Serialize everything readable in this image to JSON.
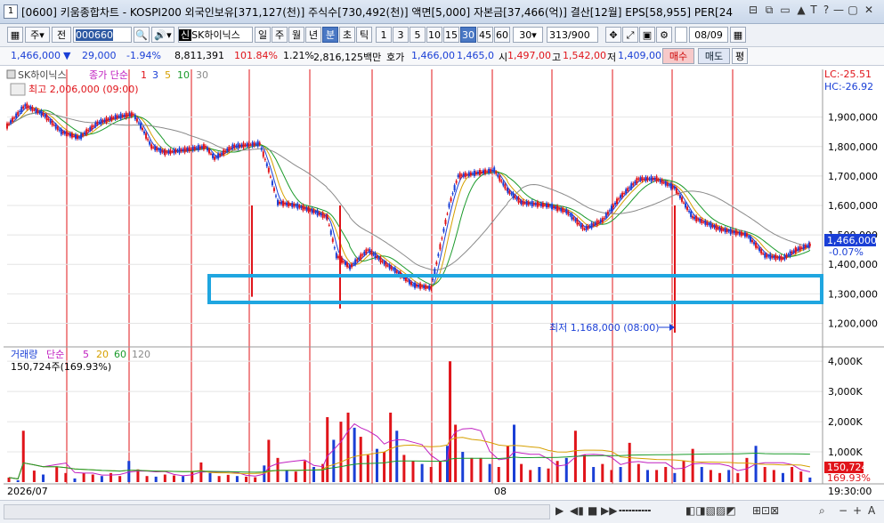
{
  "window": {
    "number": "1",
    "title": "[0600] 키움종합차트 - KOSPI200 외국인보유[371,127(천)] 주식수[730,492(천)] 액면[5,000] 자본금[37,466(억)] 결산[12월] EPS[58,955] PER[24",
    "controls": [
      "⊟",
      "⧉",
      "▭",
      "▲",
      "T",
      "?",
      "—",
      "▢",
      "✕"
    ]
  },
  "toolbar": {
    "mode1": "주",
    "mode2": "전",
    "code": "000660",
    "stock_name": "SK하이닉스",
    "periods": [
      "일",
      "주",
      "월",
      "년",
      "분",
      "초",
      "틱"
    ],
    "selected_period": "분",
    "intervals": [
      "1",
      "3",
      "5",
      "10",
      "15",
      "30",
      "45",
      "60"
    ],
    "selected_interval": "30",
    "interval_value": "30",
    "count": "313",
    "count_max": "/900",
    "date": "08/09"
  },
  "quote": {
    "price": "1,466,000",
    "arrow": "▼",
    "change": "29,000",
    "change_pct": "-1.94%",
    "volume": "8,811,391",
    "volume_ratio": "101.84%",
    "turnover": "1.21%",
    "amount": "2,816,125백만",
    "bid_label": "호가",
    "bid": "1,466,00",
    "ask": "1,465,0",
    "open_label": "시",
    "open": "1,497,00",
    "high_label": "고",
    "high": "1,542,00",
    "low_label": "저",
    "low": "1,409,00",
    "buy_label": "매수",
    "sell_label": "매도",
    "eval_label": "평"
  },
  "price_panel": {
    "legend_name": "SK하이닉스",
    "legend_ma": "종가 단순",
    "ma_periods": [
      "1",
      "3",
      "5",
      "10",
      "30"
    ],
    "high_note": "최고 2,006,000 (09:00)",
    "low_note": "최저 1,168,000 (08:00)",
    "lc": "LC:-25.51",
    "hc": "HC:-26.92",
    "current_price_tag": "1,466,000",
    "current_pct_tag": "-0.07%",
    "y_ticks": [
      "1,900,000",
      "1,800,000",
      "1,700,000",
      "1,600,000",
      "1,500,000",
      "1,400,000",
      "1,300,000",
      "1,200,000"
    ]
  },
  "volume_panel": {
    "legend_name": "거래량",
    "legend_ma": "단순",
    "ma_periods": [
      "5",
      "20",
      "60",
      "120"
    ],
    "summary": "150,724주(169.93%)",
    "current_tag": "150,724",
    "current_pct_tag": "169.93%",
    "y_ticks": [
      "4,000K",
      "3,000K",
      "2,000K",
      "1,000K"
    ]
  },
  "x_axis": {
    "labels": [
      "2026/07",
      "08"
    ],
    "time": "19:30:00"
  },
  "colors": {
    "up": "#e0141a",
    "down": "#1a3fd6",
    "highlight_box": "#1fa6e0",
    "ma1": "#e0141a",
    "ma3": "#1a3fd6",
    "ma5": "#d6a000",
    "ma10": "#1a9a2a",
    "ma30": "#8a8a8a"
  },
  "chart_data": {
    "type": "line",
    "price_path": [
      [
        0,
        1870000
      ],
      [
        20,
        1940000
      ],
      [
        40,
        1910000
      ],
      [
        60,
        1850000
      ],
      [
        80,
        1830000
      ],
      [
        100,
        1880000
      ],
      [
        120,
        1900000
      ],
      [
        140,
        1910000
      ],
      [
        150,
        1860000
      ],
      [
        160,
        1800000
      ],
      [
        175,
        1780000
      ],
      [
        200,
        1790000
      ],
      [
        220,
        1800000
      ],
      [
        230,
        1760000
      ],
      [
        250,
        1800000
      ],
      [
        280,
        1810000
      ],
      [
        290,
        1720000
      ],
      [
        300,
        1610000
      ],
      [
        320,
        1600000
      ],
      [
        340,
        1580000
      ],
      [
        355,
        1560000
      ],
      [
        365,
        1430000
      ],
      [
        380,
        1390000
      ],
      [
        400,
        1450000
      ],
      [
        420,
        1400000
      ],
      [
        430,
        1380000
      ],
      [
        450,
        1330000
      ],
      [
        470,
        1320000
      ],
      [
        490,
        1600000
      ],
      [
        500,
        1700000
      ],
      [
        520,
        1710000
      ],
      [
        540,
        1720000
      ],
      [
        555,
        1650000
      ],
      [
        570,
        1610000
      ],
      [
        600,
        1600000
      ],
      [
        620,
        1580000
      ],
      [
        640,
        1520000
      ],
      [
        660,
        1550000
      ],
      [
        680,
        1630000
      ],
      [
        700,
        1690000
      ],
      [
        720,
        1690000
      ],
      [
        740,
        1660000
      ],
      [
        760,
        1560000
      ],
      [
        790,
        1520000
      ],
      [
        820,
        1500000
      ],
      [
        840,
        1430000
      ],
      [
        860,
        1420000
      ],
      [
        875,
        1450000
      ],
      [
        890,
        1466000
      ]
    ],
    "volume_bars": [
      [
        2,
        150
      ],
      [
        12,
        60
      ],
      [
        18,
        1700
      ],
      [
        30,
        380
      ],
      [
        40,
        250
      ],
      [
        55,
        520
      ],
      [
        65,
        300
      ],
      [
        75,
        120
      ],
      [
        85,
        300
      ],
      [
        95,
        250
      ],
      [
        105,
        200
      ],
      [
        115,
        300
      ],
      [
        125,
        200
      ],
      [
        135,
        700
      ],
      [
        145,
        420
      ],
      [
        155,
        200
      ],
      [
        165,
        180
      ],
      [
        175,
        250
      ],
      [
        185,
        220
      ],
      [
        195,
        200
      ],
      [
        205,
        340
      ],
      [
        215,
        650
      ],
      [
        225,
        300
      ],
      [
        235,
        200
      ],
      [
        245,
        240
      ],
      [
        255,
        200
      ],
      [
        265,
        180
      ],
      [
        275,
        160
      ],
      [
        285,
        550
      ],
      [
        290,
        1400
      ],
      [
        300,
        800
      ],
      [
        310,
        400
      ],
      [
        320,
        350
      ],
      [
        330,
        700
      ],
      [
        340,
        500
      ],
      [
        350,
        600
      ],
      [
        355,
        2150
      ],
      [
        362,
        1400
      ],
      [
        370,
        2000
      ],
      [
        378,
        2300
      ],
      [
        385,
        1800
      ],
      [
        392,
        1500
      ],
      [
        400,
        900
      ],
      [
        410,
        1100
      ],
      [
        418,
        1000
      ],
      [
        425,
        2300
      ],
      [
        432,
        1700
      ],
      [
        440,
        900
      ],
      [
        450,
        700
      ],
      [
        460,
        600
      ],
      [
        470,
        500
      ],
      [
        480,
        700
      ],
      [
        488,
        1200
      ],
      [
        491,
        4000
      ],
      [
        497,
        1900
      ],
      [
        505,
        1000
      ],
      [
        515,
        800
      ],
      [
        525,
        800
      ],
      [
        535,
        600
      ],
      [
        545,
        500
      ],
      [
        555,
        1200
      ],
      [
        562,
        1900
      ],
      [
        570,
        600
      ],
      [
        580,
        400
      ],
      [
        590,
        500
      ],
      [
        600,
        450
      ],
      [
        610,
        700
      ],
      [
        620,
        800
      ],
      [
        630,
        1700
      ],
      [
        640,
        900
      ],
      [
        650,
        500
      ],
      [
        660,
        600
      ],
      [
        670,
        400
      ],
      [
        680,
        500
      ],
      [
        690,
        1300
      ],
      [
        700,
        600
      ],
      [
        710,
        400
      ],
      [
        720,
        400
      ],
      [
        730,
        500
      ],
      [
        740,
        300
      ],
      [
        750,
        700
      ],
      [
        760,
        1100
      ],
      [
        770,
        500
      ],
      [
        780,
        400
      ],
      [
        790,
        300
      ],
      [
        800,
        400
      ],
      [
        810,
        300
      ],
      [
        820,
        800
      ],
      [
        830,
        1200
      ],
      [
        840,
        500
      ],
      [
        850,
        400
      ],
      [
        860,
        300
      ],
      [
        870,
        500
      ],
      [
        880,
        350
      ],
      [
        890,
        150
      ]
    ],
    "ylim": [
      1150000,
      2050000
    ],
    "volume_ylim": [
      0,
      4300
    ]
  }
}
